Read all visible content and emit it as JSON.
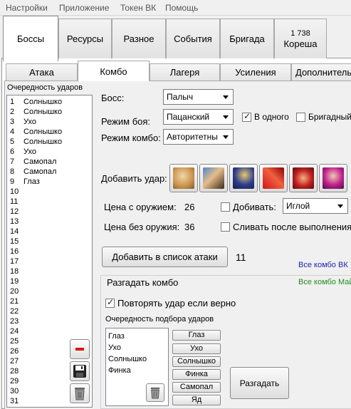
{
  "menu": [
    "Настройки",
    "Приложение",
    "Токен ВК",
    "Помощь"
  ],
  "main_tabs": [
    {
      "label": "Боссы",
      "badge": ""
    },
    {
      "label": "Ресурсы",
      "badge": ""
    },
    {
      "label": "Разное",
      "badge": ""
    },
    {
      "label": "События",
      "badge": ""
    },
    {
      "label": "Бригада",
      "badge": ""
    },
    {
      "label": "Кореша",
      "badge": "1 738"
    }
  ],
  "sub_tabs": [
    "Атака",
    "Комбо",
    "Лагеря",
    "Усиления",
    "Дополнительно"
  ],
  "order": {
    "title": "Очередность ударов",
    "rows": [
      {
        "n": "1",
        "name": "Солнышко"
      },
      {
        "n": "2",
        "name": "Солнышко"
      },
      {
        "n": "3",
        "name": "Ухо"
      },
      {
        "n": "4",
        "name": "Солнышко"
      },
      {
        "n": "5",
        "name": "Солнышко"
      },
      {
        "n": "6",
        "name": "Ухо"
      },
      {
        "n": "7",
        "name": "Самопал"
      },
      {
        "n": "8",
        "name": "Самопал"
      },
      {
        "n": "9",
        "name": "Глаз"
      },
      {
        "n": "10",
        "name": ""
      },
      {
        "n": "11",
        "name": ""
      },
      {
        "n": "12",
        "name": ""
      },
      {
        "n": "13",
        "name": ""
      },
      {
        "n": "14",
        "name": ""
      },
      {
        "n": "15",
        "name": ""
      },
      {
        "n": "16",
        "name": ""
      },
      {
        "n": "17",
        "name": ""
      },
      {
        "n": "18",
        "name": ""
      },
      {
        "n": "19",
        "name": ""
      },
      {
        "n": "20",
        "name": ""
      },
      {
        "n": "21",
        "name": ""
      },
      {
        "n": "22",
        "name": ""
      },
      {
        "n": "23",
        "name": ""
      },
      {
        "n": "24",
        "name": ""
      },
      {
        "n": "25",
        "name": ""
      },
      {
        "n": "26",
        "name": ""
      },
      {
        "n": "27",
        "name": ""
      },
      {
        "n": "28",
        "name": ""
      },
      {
        "n": "29",
        "name": ""
      },
      {
        "n": "30",
        "name": ""
      },
      {
        "n": "31",
        "name": ""
      }
    ]
  },
  "form": {
    "boss_label": "Босс:",
    "boss_value": "Палыч",
    "mode_label": "Режим боя:",
    "mode_value": "Пацанский",
    "one_label": "В одного",
    "one_checked": true,
    "brigade_label": "Бригадный",
    "brigade_checked": false,
    "combo_label": "Режим комбо:",
    "combo_value": "Авторитетны",
    "add_hit_label": "Добавить удар:",
    "price_weapon_label": "Цена с оружием:",
    "price_weapon_value": "26",
    "price_noweapon_label": "Цена без оружия:",
    "price_noweapon_value": "36",
    "finish_label": "Добивать:",
    "finish_checked": false,
    "finish_value": "Иглой",
    "merge_label": "Сливать после выполнения",
    "merge_checked": false,
    "add_to_list_label": "Добавить в список атаки",
    "attack_count": "11",
    "link_vk": "Все комбо ВК",
    "link_mail": "Все комбо Майл"
  },
  "hit_icons": [
    "hit-icon-1",
    "hit-icon-2",
    "hit-icon-3",
    "hit-icon-4",
    "hit-icon-5",
    "hit-icon-6"
  ],
  "guess": {
    "legend": "Разгадать комбо",
    "repeat_label": "Повторять удар если верно",
    "repeat_checked": true,
    "order_label": "Очередность подбора ударов",
    "list": [
      "Глаз",
      "Ухо",
      "Солнышко",
      "Финка"
    ],
    "buttons": [
      "Глаз",
      "Ухо",
      "Солнышко",
      "Финка",
      "Самопал",
      "Яд"
    ],
    "solve_label": "Разгадать"
  },
  "colors": {
    "link_vk": "#1f1fb4",
    "link_mail": "#1f8c1f",
    "minus": "#d81818"
  }
}
